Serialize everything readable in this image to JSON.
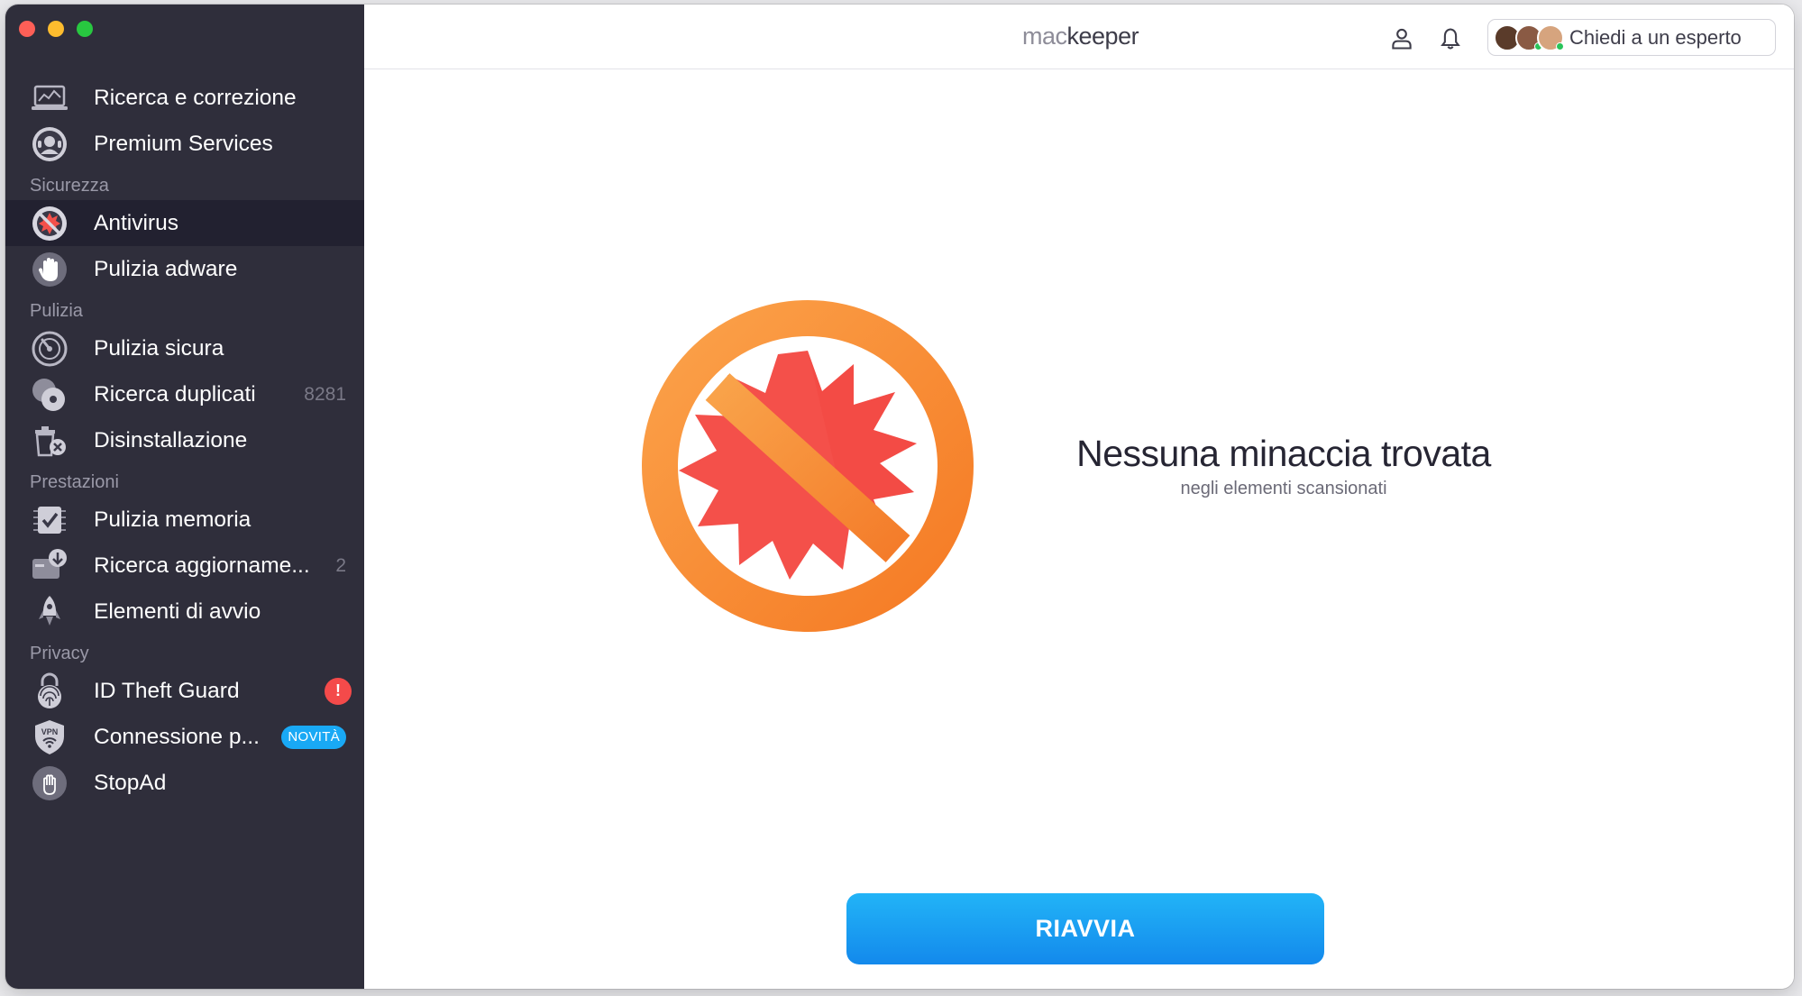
{
  "app": {
    "logo_prefix": "mac",
    "logo_suffix": "keeper"
  },
  "colors": {
    "sidebar_bg": "#2f2e3b",
    "active_bg": "#222130",
    "accent_blue": "#1a9ef3",
    "alert_red": "#f44a4a",
    "hero_orange": "#f98a2c",
    "hero_red": "#f4504a"
  },
  "sidebar": {
    "top_items": [
      {
        "label": "Ricerca e correzione",
        "icon": "laptop-scan-icon"
      },
      {
        "label": "Premium Services",
        "icon": "support-agent-icon"
      }
    ],
    "sections": [
      {
        "title": "Sicurezza",
        "items": [
          {
            "label": "Antivirus",
            "icon": "antivirus-icon",
            "active": true
          },
          {
            "label": "Pulizia adware",
            "icon": "hand-stop-icon"
          }
        ]
      },
      {
        "title": "Pulizia",
        "items": [
          {
            "label": "Pulizia sicura",
            "icon": "disk-clean-icon"
          },
          {
            "label": "Ricerca duplicati",
            "icon": "duplicates-icon",
            "count": "8281"
          },
          {
            "label": "Disinstallazione",
            "icon": "trash-x-icon"
          }
        ]
      },
      {
        "title": "Prestazioni",
        "items": [
          {
            "label": "Pulizia memoria",
            "icon": "memory-chip-icon"
          },
          {
            "label": "Ricerca aggiorname...",
            "icon": "update-download-icon",
            "count": "2"
          },
          {
            "label": "Elementi di avvio",
            "icon": "rocket-icon"
          }
        ]
      },
      {
        "title": "Privacy",
        "items": [
          {
            "label": "ID Theft Guard",
            "icon": "fingerprint-lock-icon",
            "alert": "!"
          },
          {
            "label": "Connessione p...",
            "icon": "vpn-shield-icon",
            "badge": "NOVITÀ"
          },
          {
            "label": "StopAd",
            "icon": "stopad-hand-icon"
          }
        ]
      }
    ]
  },
  "header": {
    "expert_label": "Chiedi a un esperto"
  },
  "main": {
    "title": "Nessuna minaccia trovata",
    "subtitle": "negli elementi scansionati",
    "restart_label": "RIAVVIA"
  }
}
